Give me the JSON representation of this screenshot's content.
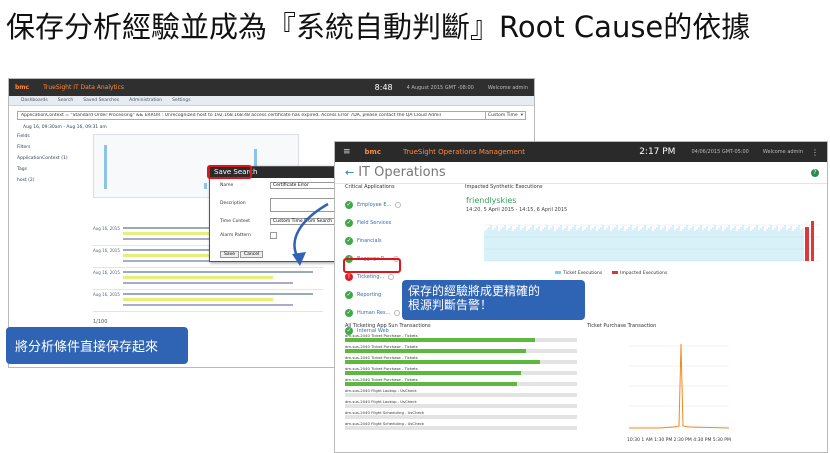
{
  "slide": {
    "title": "保存分析經驗並成為『系統自動判斷』Root Cause的依據"
  },
  "left_app": {
    "brand": "bmc",
    "product": "TrueSight IT Data Analytics",
    "time": "8:48",
    "date": "4 August 2015 GMT -08:00",
    "user": "Welcome admin",
    "tabs": [
      "Dashboards",
      "Search",
      "Saved Searches",
      "Administration",
      "Settings"
    ],
    "query": "ApplicationContext = \"Standard Order Processing\" && ERROR : Unrecognized host to 192.168.168.48 access certificate has expired. Access Error 7DA, please contact the QA Cloud Administrator",
    "time_picker": "Custom Time",
    "range": "Aug 16, 09:30am - Aug 16, 09:31 am",
    "side_items": [
      "Fields",
      "Filters",
      "ApplicationContext (1)",
      "Tags",
      "host (2)"
    ],
    "pager": "1/100",
    "callout": "將分析條件直接保存起來"
  },
  "dialog": {
    "title": "Save Search",
    "name_label": "Name",
    "name_value": "Certificate Error",
    "description_label": "Description",
    "time_context_label": "Time Context",
    "time_context_value": "Custom Time From Search",
    "alarm_label": "Alarm Pattern",
    "save_label": "Save",
    "cancel_label": "Cancel"
  },
  "right_app": {
    "brand": "bmc",
    "product": "TrueSight Operations Management",
    "time": "2:17 PM",
    "date": "04/06/2015 GMT-05:00",
    "user": "Welcome admin",
    "page_title": "IT Operations",
    "apps_label": "Critical Applications",
    "apps": [
      {
        "name": "Employee E...",
        "status": "ok"
      },
      {
        "name": "Field Services",
        "status": "ok"
      },
      {
        "name": "Financials",
        "status": "ok"
      },
      {
        "name": "Baggage R...",
        "status": "ok"
      },
      {
        "name": "Ticketing...",
        "status": "critical"
      },
      {
        "name": "Reporting",
        "status": "ok"
      },
      {
        "name": "Human Res...",
        "status": "ok"
      },
      {
        "name": "Internal Web",
        "status": "ok"
      }
    ],
    "impacted_label": "Impacted Synthetic Executions",
    "impacted_app": "friendlyskies",
    "impacted_range": "14:20, 5 April 2015 - 14:15, 6 April 2015",
    "legend": [
      "Ticket Executions",
      "Impacted Executions"
    ],
    "callout_line1": "保存的經驗將成更精確的",
    "callout_line2": "根源判斷告警！",
    "tx_label": "All Ticketing App Sun Transactions",
    "transactions": [
      {
        "name": "dm-sus-2040 Ticket Purchase - Tickets",
        "fill": 0.82
      },
      {
        "name": "dm-sus-2040 Ticket Purchase - Tickets",
        "fill": 0.78
      },
      {
        "name": "dm-sus-2040 Ticket Purchase - Tickets",
        "fill": 0.84
      },
      {
        "name": "dm-sus-2040 Ticket Purchase - Tickets",
        "fill": 0.76
      },
      {
        "name": "dm-sus-2040 Ticket Purchase - Tickets",
        "fill": 0.74
      },
      {
        "name": "dm-sus-2040 Flight Lookup - UsCheck",
        "fill": 0.0
      },
      {
        "name": "dm-sus-2040 Flight Lookup - UsCheck",
        "fill": 0.0
      },
      {
        "name": "dm-sus-2040 Flight Scheduling - UsCheck",
        "fill": 0.0
      },
      {
        "name": "dm-sus-2040 Flight Scheduling - UsCheck",
        "fill": 0.0
      }
    ],
    "tp_label": "Ticket Purchase Transaction",
    "tp_axis": "10:30 1 AM 1:30 PM 2:30 PM 4:30 PM 5:30 PM"
  },
  "colors": {
    "callout_blue": "#2f63b3",
    "highlight_red": "#e0141b",
    "ok_green": "#41a847",
    "brand_orange": "#ff8a3d"
  }
}
